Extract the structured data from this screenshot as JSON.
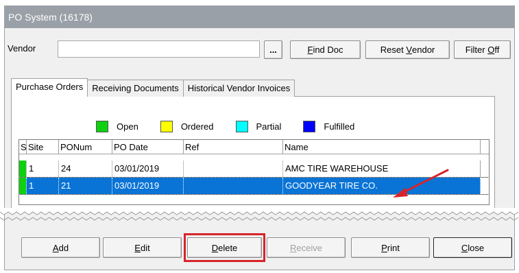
{
  "window": {
    "title": "PO System (16178)"
  },
  "vendor": {
    "label": "Vendor",
    "value": ""
  },
  "toolbar": {
    "ellipsis_label": "...",
    "find_doc_prefix": "",
    "find_doc_mnemonic": "F",
    "find_doc_rest": "ind Doc",
    "reset_prefix": "Reset ",
    "reset_mnemonic": "V",
    "reset_rest": "endor",
    "filter_prefix": "Filter ",
    "filter_mnemonic": "O",
    "filter_rest": "ff"
  },
  "tabs": [
    {
      "label": "Purchase Orders",
      "active": true
    },
    {
      "label": "Receiving Documents",
      "active": false
    },
    {
      "label": "Historical Vendor Invoices",
      "active": false
    }
  ],
  "legend": [
    {
      "label": "Open",
      "color": "#10d010"
    },
    {
      "label": "Ordered",
      "color": "#ffff00"
    },
    {
      "label": "Partial",
      "color": "#00ffff"
    },
    {
      "label": "Fulfilled",
      "color": "#0000ff"
    }
  ],
  "grid": {
    "columns": [
      "S",
      "Site",
      "PONum",
      "PO Date",
      "Ref",
      "Name"
    ],
    "rows": [
      {
        "status_color": "#10d010",
        "site": "1",
        "ponum": "24",
        "po_date": "03/01/2019",
        "ref": "",
        "name": "AMC TIRE WAREHOUSE",
        "selected": false
      },
      {
        "status_color": "#10d010",
        "site": "1",
        "ponum": "21",
        "po_date": "03/01/2019",
        "ref": "",
        "name": "GOODYEAR TIRE CO.",
        "selected": true
      }
    ]
  },
  "buttons": {
    "add": {
      "mnemonic": "A",
      "rest": "dd"
    },
    "edit": {
      "mnemonic": "E",
      "rest": "dit"
    },
    "delete": {
      "mnemonic": "D",
      "rest": "elete"
    },
    "receive": {
      "mnemonic": "R",
      "rest": "eceive"
    },
    "print": {
      "mnemonic": "P",
      "rest": "rint"
    },
    "close": {
      "mnemonic": "C",
      "rest": "lose"
    }
  },
  "colors": {
    "selection": "#0a74d6",
    "annotation": "#d8232a",
    "titlebar": "#9aa0a7"
  }
}
